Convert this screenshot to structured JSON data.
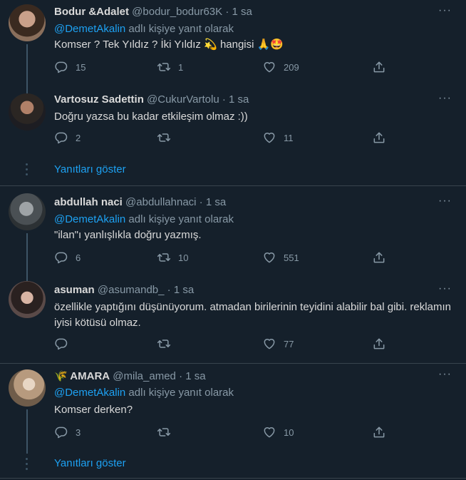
{
  "tweets": [
    {
      "name": "Bodur &Adalet",
      "handle": "@bodur_bodur63K",
      "dot": "·",
      "time": "1 sa",
      "reply_mention": "@DemetAkalin",
      "reply_suffix": " adlı kişiye yanıt olarak",
      "text": "Komser ?  Tek Yıldız ? İki Yıldız 💫 hangisi 🙏🤩",
      "replies": "15",
      "retweets": "1",
      "likes": "209"
    },
    {
      "name": "Vartosuz Sadettin",
      "handle": "@CukurVartolu",
      "dot": "·",
      "time": "1 sa",
      "text": "Doğru yazsa bu kadar etkileşim olmaz :))",
      "replies": "2",
      "retweets": "",
      "likes": "11"
    },
    {
      "name": "abdullah naci",
      "handle": "@abdullahnaci",
      "dot": "·",
      "time": "1 sa",
      "reply_mention": "@DemetAkalin",
      "reply_suffix": " adlı kişiye yanıt olarak",
      "text": "\"ilan\"ı yanlışlıkla doğru yazmış.",
      "replies": "6",
      "retweets": "10",
      "likes": "551"
    },
    {
      "name": "asuman",
      "handle": "@asumandb_",
      "dot": "·",
      "time": "1 sa",
      "text": "özellikle yaptığını düşünüyorum. atmadan birilerinin teyidini alabilir bal gibi. reklamın iyisi kötüsü olmaz.",
      "replies": "",
      "retweets": "",
      "likes": "77"
    },
    {
      "name": "🌾 AMARA",
      "handle": "@mila_amed",
      "dot": "·",
      "time": "1 sa",
      "reply_mention": "@DemetAkalin",
      "reply_suffix": " adlı kişiye yanıt olarak",
      "text": "Komser derken?",
      "replies": "3",
      "retweets": "",
      "likes": "10"
    }
  ],
  "show_replies_label": "Yanıtları göster",
  "more_label": "···",
  "colors": {
    "background": "#15202b",
    "accent": "#1da1f2",
    "muted": "#8899a6",
    "border": "#38444d"
  },
  "icons": [
    "reply-icon",
    "retweet-icon",
    "like-icon",
    "share-icon",
    "more-icon"
  ]
}
